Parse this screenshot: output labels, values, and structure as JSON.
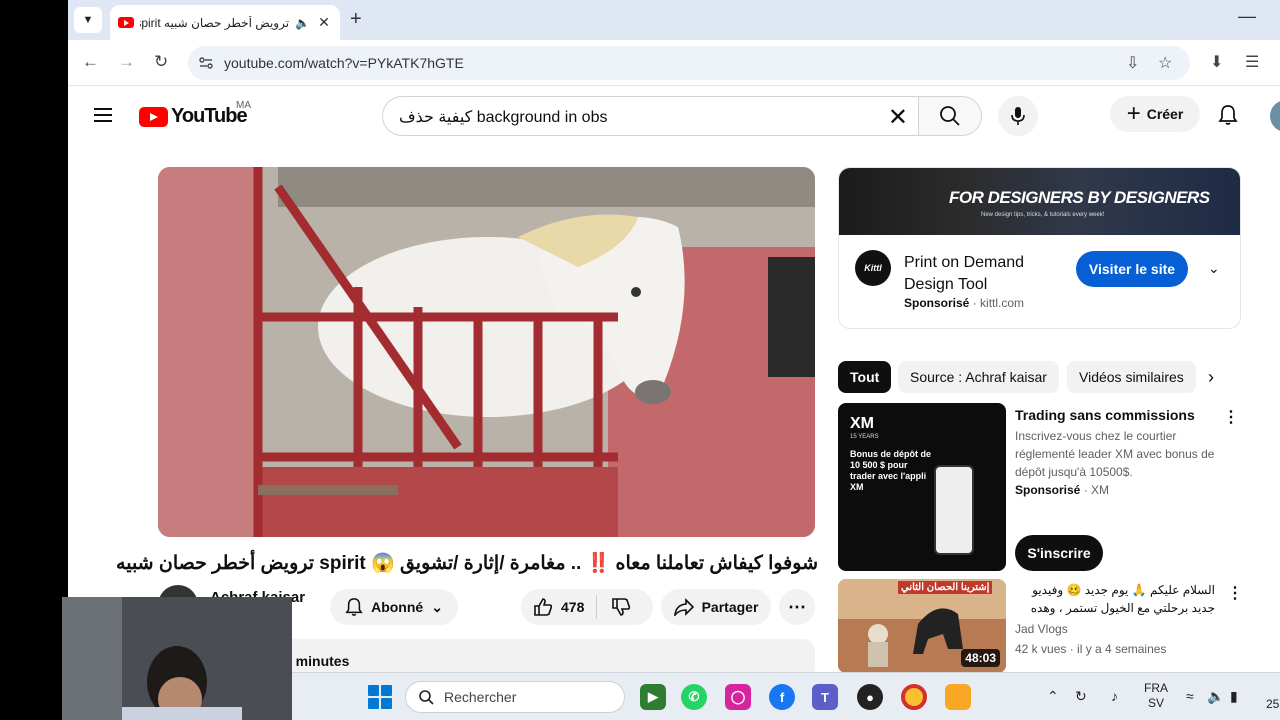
{
  "browser": {
    "tab_title": "ترويض أخطر حصان شبيه spirit",
    "url": "youtube.com/watch?v=PYkATK7hGTE"
  },
  "header": {
    "logo_text": "YouTube",
    "country": "MA",
    "search_value": "كيفية حذف background in obs",
    "create_label": "Créer"
  },
  "video": {
    "title": "شوفوا كيفاش تعاملنا معاه ‼️ .. مغامرة /إثارة /تشويق 😱 spirit ترويض أخطر حصان شبيه",
    "channel": "Achraf kaisar",
    "subscribe_label": "Abonné",
    "likes": "478",
    "share_label": "Partager",
    "description_partial": "7 minutes"
  },
  "sidebar_ad": {
    "banner_title": "FOR DESIGNERS BY DESIGNERS",
    "banner_sub": "New design tips, tricks, & tutorials every week!",
    "logo_text": "Kittl",
    "title": "Print on Demand Design Tool",
    "sponsored_label": "Sponsorisé",
    "domain": "kittl.com",
    "cta_label": "Visiter le site"
  },
  "chips": [
    "Tout",
    "Source : Achraf kaisar",
    "Vidéos similaires"
  ],
  "recommendations": [
    {
      "title": "Trading sans commissions",
      "description": "Inscrivez-vous chez le courtier réglementé leader XM avec bonus de dépôt jusqu'à 10500$.",
      "sponsored_label": "Sponsorisé",
      "advertiser": "XM",
      "cta_label": "S'inscrire",
      "thumb_brand": "XM",
      "thumb_sub": "15 YEARS",
      "thumb_text": "Bonus de dépôt de 10 500 $ pour trader avec l'appli XM"
    },
    {
      "title": "السلام عليكم 🙏 يوم جديد 🥴 وفيديو جديد برحلتي مع الخيول تستمر ، وهده المرة مع...",
      "channel": "Jad Vlogs",
      "views": "42 k vues",
      "age": "il y a 4 semaines",
      "duration": "48:03",
      "thumb_text": "إشترينا الحصان الثاني"
    }
  ],
  "taskbar": {
    "search_placeholder": "Rechercher",
    "lang_line1": "FRA",
    "lang_line2": "SV",
    "clock": "25"
  },
  "colors": {
    "youtube_red": "#ff0000",
    "cta_blue": "#065fd4",
    "chip_active": "#0f0f0f"
  }
}
